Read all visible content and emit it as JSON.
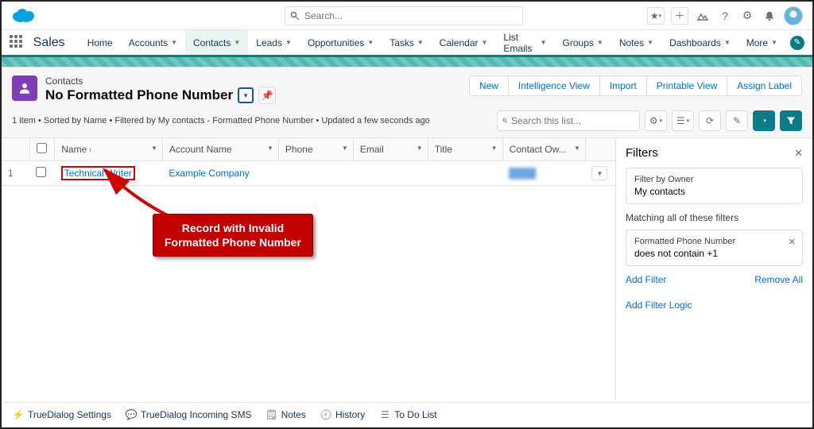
{
  "header": {
    "search_placeholder": "Search...",
    "icons": {
      "star": "star-icon",
      "add": "plus-icon",
      "trail": "trailhead-icon",
      "help": "help-icon",
      "setup": "gear-icon",
      "notif": "bell-icon"
    },
    "app_name": "Sales",
    "nav_items": [
      "Home",
      "Accounts",
      "Contacts",
      "Leads",
      "Opportunities",
      "Tasks",
      "Calendar",
      "List Emails",
      "Groups",
      "Notes",
      "Dashboards",
      "More"
    ],
    "nav_active_index": 2
  },
  "page_header": {
    "object_label": "Contacts",
    "list_view_name": "No Formatted Phone Number",
    "meta_line": "1 item • Sorted by Name • Filtered by My contacts - Formatted Phone Number • Updated a few seconds ago",
    "actions": [
      "New",
      "Intelligence View",
      "Import",
      "Printable View",
      "Assign Label"
    ],
    "list_search_placeholder": "Search this list..."
  },
  "table": {
    "columns": [
      "",
      "",
      "Name",
      "Account Name",
      "Phone",
      "Email",
      "Title",
      "Contact Ow...",
      ""
    ],
    "rows": [
      {
        "num": "1",
        "name": "Technical Writer",
        "account": "Example Company",
        "phone": "",
        "email": "",
        "title": "",
        "owner": "blurred"
      }
    ]
  },
  "filters": {
    "title": "Filters",
    "owner_card": {
      "label": "Filter by Owner",
      "value": "My contacts"
    },
    "match_label": "Matching all of these filters",
    "criteria": [
      {
        "label": "Formatted Phone Number",
        "value": "does not contain  +1"
      }
    ],
    "add_filter": "Add Filter",
    "remove_all": "Remove All",
    "add_logic": "Add Filter Logic"
  },
  "annotation": {
    "line1": "Record with Invalid",
    "line2": "Formatted Phone Number"
  },
  "footer": {
    "items": [
      "TrueDialog Settings",
      "TrueDialog Incoming SMS",
      "Notes",
      "History",
      "To Do List"
    ]
  }
}
